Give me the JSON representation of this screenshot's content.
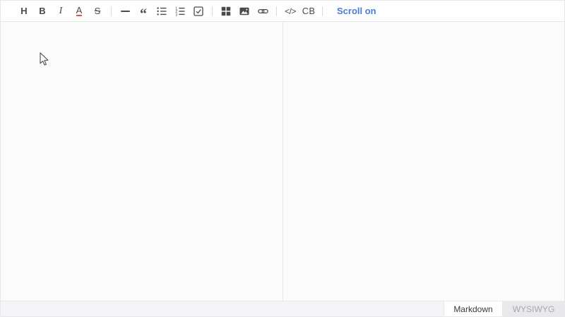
{
  "toolbar": {
    "heading_label": "H",
    "bold_label": "B",
    "italic_label": "I",
    "color_label": "A",
    "strike_label": "S",
    "quote_glyph": "“",
    "code_label": "</>",
    "codeblock_label": "CB",
    "scroll_toggle_label": "Scroll on",
    "icons": {
      "hr": "hr-icon",
      "bullet_list": "bullet-list-icon",
      "ordered_list": "ordered-list-icon",
      "task_list": "task-list-icon",
      "table": "table-icon",
      "image": "image-icon",
      "link": "link-icon"
    }
  },
  "editor": {
    "markdown_pane_text": "",
    "preview_pane_text": ""
  },
  "mode_tabs": {
    "markdown_label": "Markdown",
    "wysiwyg_label": "WYSIWYG",
    "active": "Markdown"
  },
  "colors": {
    "accent_blue": "#4b7dd2",
    "icon_gray": "#4a4a4a",
    "color_underline_red": "#e0574a",
    "toolbar_border": "#e5e4e6",
    "mode_bar_bg": "#f5f4f6",
    "inactive_tab_bg": "#e9e8ea",
    "inactive_tab_text": "#a9a9ad"
  }
}
